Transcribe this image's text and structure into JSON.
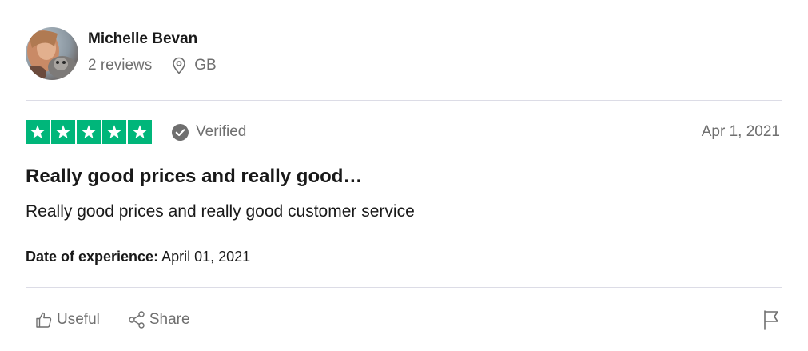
{
  "reviewer": {
    "name": "Michelle Bevan",
    "reviews_count": "2 reviews",
    "country": "GB"
  },
  "review": {
    "rating": 5,
    "max_rating": 5,
    "verified_label": "Verified",
    "date": "Apr 1, 2021",
    "title": "Really good prices and really good…",
    "body": "Really good prices and really good customer service",
    "experience_label": "Date of experience:",
    "experience_date": "April 01, 2021"
  },
  "actions": {
    "useful_label": "Useful",
    "share_label": "Share"
  },
  "colors": {
    "star_green": "#00b67a",
    "text_dark": "#191919",
    "text_muted": "#6f6f6f",
    "divider": "#dcdce6"
  },
  "icons": {
    "location": "map-pin-icon",
    "verified": "check-circle-icon",
    "useful": "thumbs-up-icon",
    "share": "share-icon",
    "flag": "flag-icon",
    "star": "star-icon"
  }
}
